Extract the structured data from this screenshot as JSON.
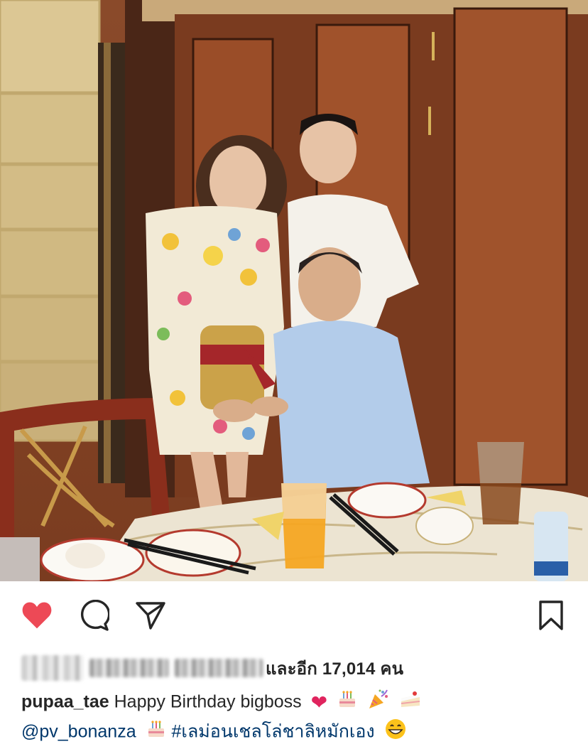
{
  "post": {
    "likes": {
      "text": "และอีก 17,014 คน"
    },
    "caption": {
      "username": "pupaa_tae",
      "text": "Happy Birthday bigboss",
      "mention": "@pv_bonanza",
      "hashtag": "#เลม่อนเชลโล่ชาลิหมักเอง"
    },
    "icons": {
      "like": "heart-icon",
      "comment": "comment-icon",
      "share": "share-icon",
      "save": "bookmark-icon"
    },
    "colors": {
      "like_red": "#ed4956",
      "link_blue": "#00376b",
      "text": "#262626"
    }
  }
}
